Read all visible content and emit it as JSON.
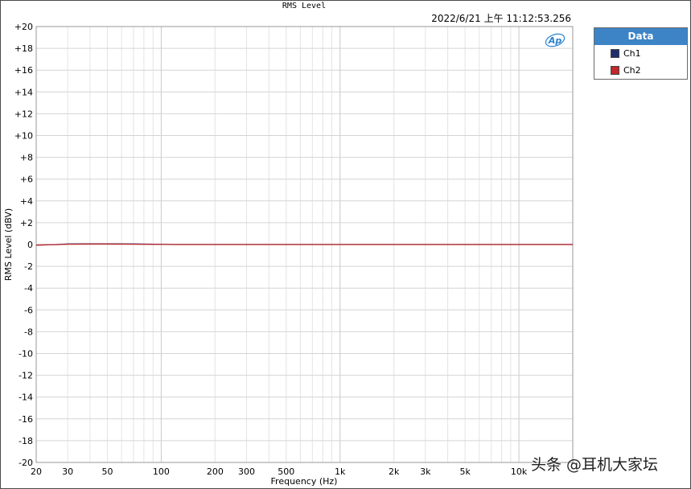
{
  "chart_data": {
    "type": "line",
    "title": "RMS Level",
    "timestamp": "2022/6/21 上午 11:12:53.256",
    "xlabel": "Frequency (Hz)",
    "ylabel": "RMS Level (dBV)",
    "x_scale": "log",
    "xlim": [
      20,
      20000
    ],
    "ylim": [
      -20,
      20
    ],
    "grid": true,
    "x_ticks": [
      20,
      30,
      50,
      100,
      200,
      300,
      500,
      1000,
      2000,
      3000,
      5000,
      10000
    ],
    "x_tick_labels": [
      "20",
      "30",
      "50",
      "100",
      "200",
      "300",
      "500",
      "1k",
      "2k",
      "3k",
      "5k",
      "10k"
    ],
    "y_ticks": [
      20,
      18,
      16,
      14,
      12,
      10,
      8,
      6,
      4,
      2,
      0,
      -2,
      -4,
      -6,
      -8,
      -10,
      -12,
      -14,
      -16,
      -18,
      -20
    ],
    "y_tick_labels": [
      "+20",
      "+18",
      "+16",
      "+14",
      "+12",
      "+10",
      "+8",
      "+6",
      "+4",
      "+2",
      "0",
      "-2",
      "-4",
      "-6",
      "-8",
      "-10",
      "-12",
      "-14",
      "-16",
      "-18",
      "-20"
    ],
    "legend_position": "top-right outside",
    "legend_title": "Data",
    "series": [
      {
        "name": "Ch1",
        "color": "#1f2f6e",
        "x": [
          20,
          25,
          30,
          40,
          50,
          70,
          100,
          120,
          150,
          200,
          500,
          1000,
          2000,
          5000,
          10000,
          20000
        ],
        "y": [
          -0.05,
          -0.02,
          0.05,
          0.06,
          0.06,
          0.05,
          0.02,
          0.0,
          0.0,
          0.0,
          0.0,
          0.0,
          0.0,
          0.0,
          0.0,
          0.0
        ]
      },
      {
        "name": "Ch2",
        "color": "#c0282b",
        "x": [
          20,
          25,
          30,
          40,
          50,
          70,
          100,
          120,
          150,
          200,
          500,
          1000,
          2000,
          5000,
          10000,
          20000
        ],
        "y": [
          -0.05,
          -0.02,
          0.03,
          0.04,
          0.04,
          0.03,
          0.01,
          0.0,
          0.0,
          0.0,
          0.0,
          0.0,
          0.0,
          0.0,
          0.0,
          0.0
        ]
      }
    ]
  },
  "ap_logo": "Ap",
  "watermark": "头条 @耳机大家坛"
}
